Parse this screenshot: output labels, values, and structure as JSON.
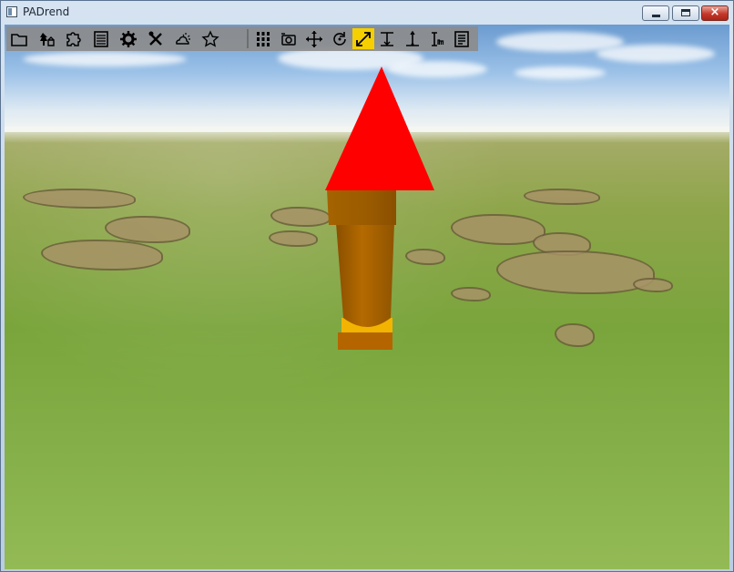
{
  "window": {
    "title": "PADrend",
    "close_glyph": "×"
  },
  "toolbar": {
    "tools": [
      {
        "icon": "folder-icon"
      },
      {
        "icon": "scene-tree-icon"
      },
      {
        "icon": "puzzle-icon"
      },
      {
        "icon": "list-panel-icon"
      },
      {
        "icon": "gear-icon"
      },
      {
        "icon": "tools-icon"
      },
      {
        "icon": "sun-cloud-icon"
      },
      {
        "icon": "star-icon"
      },
      {
        "icon": "numpad-icon"
      },
      {
        "icon": "camera-icon"
      },
      {
        "icon": "move-icon"
      },
      {
        "icon": "rotate-icon"
      },
      {
        "icon": "scale-icon",
        "active": true
      },
      {
        "icon": "snap-to-ground-icon"
      },
      {
        "icon": "align-axis-icon"
      },
      {
        "icon": "measure-icon"
      },
      {
        "icon": "notes-icon"
      }
    ],
    "active_color": "#f5cf00"
  },
  "scene": {
    "object_colors": {
      "cone": "#ff0000",
      "cylinder": "#b56a00",
      "base": "#f2b400"
    }
  }
}
